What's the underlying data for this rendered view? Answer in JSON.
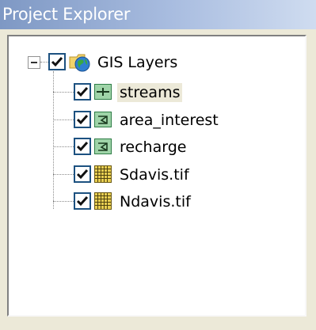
{
  "window": {
    "title": "Project Explorer"
  },
  "tree": {
    "root": {
      "label": "GIS Layers",
      "checked": true,
      "expanded": true,
      "icon": "globe-folder-icon"
    },
    "layers": [
      {
        "label": "streams",
        "checked": true,
        "icon": "line-layer-icon",
        "selected": true
      },
      {
        "label": "area_interest",
        "checked": true,
        "icon": "polygon-layer-icon",
        "selected": false
      },
      {
        "label": "recharge",
        "checked": true,
        "icon": "polygon-layer-icon",
        "selected": false
      },
      {
        "label": "Sdavis.tif",
        "checked": true,
        "icon": "raster-grid-icon",
        "selected": false
      },
      {
        "label": "Ndavis.tif",
        "checked": true,
        "icon": "raster-grid-icon",
        "selected": false
      }
    ]
  },
  "colors": {
    "titlebar_start": "#7e98c4",
    "titlebar_end": "#cfdcf0",
    "checkbox_border": "#1c5180",
    "background": "#ece9d8"
  }
}
